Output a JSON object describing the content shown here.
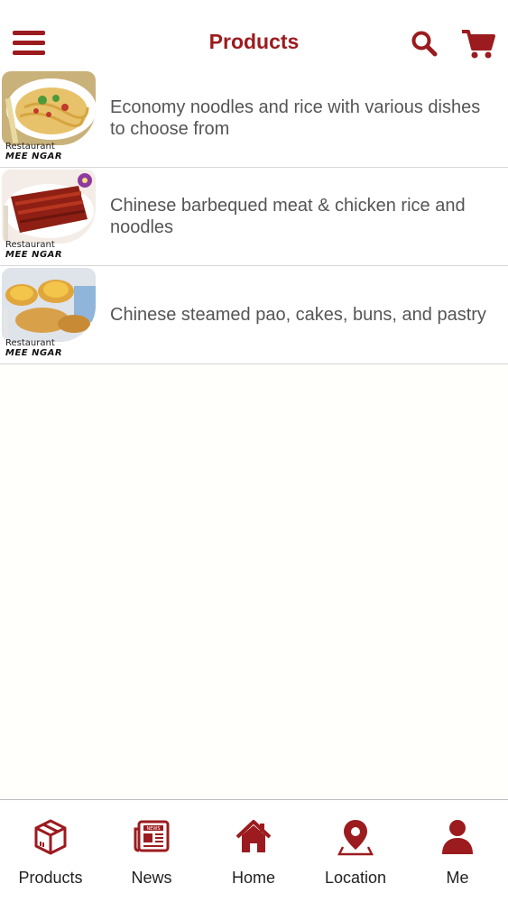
{
  "header": {
    "title": "Products",
    "menu_icon": "hamburger-menu-icon",
    "search_icon": "search-icon",
    "cart_icon": "shopping-cart-icon"
  },
  "brand": {
    "top": "Restaurant",
    "bottom": "MEE NGAR"
  },
  "products": [
    {
      "text": "Economy noodles and rice with various dishes to choose from"
    },
    {
      "text": "Chinese barbequed meat & chicken rice and noodles"
    },
    {
      "text": "Chinese steamed pao, cakes, buns, and pastry"
    }
  ],
  "tabs": [
    {
      "label": "Products",
      "icon": "package-box-icon"
    },
    {
      "label": "News",
      "icon": "newspaper-icon"
    },
    {
      "label": "Home",
      "icon": "home-icon"
    },
    {
      "label": "Location",
      "icon": "map-pin-icon"
    },
    {
      "label": "Me",
      "icon": "user-icon"
    }
  ],
  "colors": {
    "brand": "#9b1b1f",
    "text": "#555555",
    "background": "#fffffc"
  }
}
